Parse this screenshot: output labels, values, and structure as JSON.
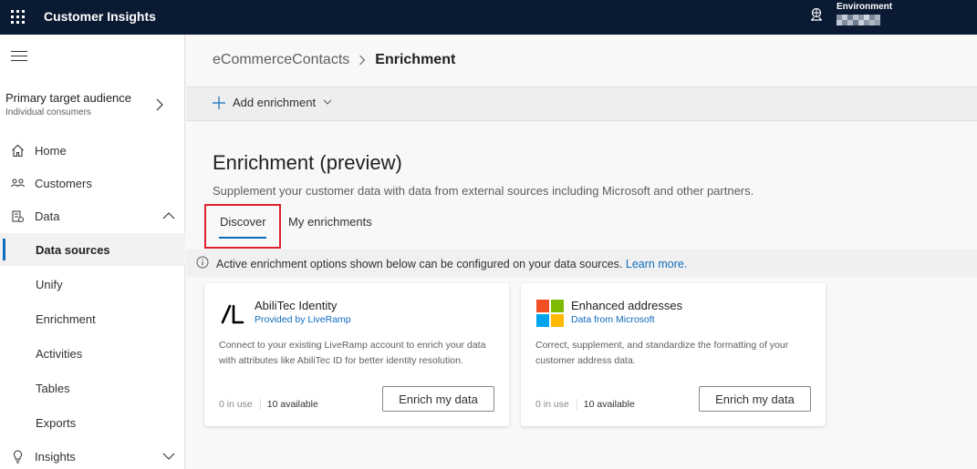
{
  "app": {
    "title": "Customer Insights"
  },
  "environment": {
    "label": "Environment",
    "value_icon": "redacted-value"
  },
  "sidebar": {
    "audience": {
      "title": "Primary target audience",
      "subtitle": "Individual consumers"
    },
    "items": [
      {
        "label": "Home",
        "icon": "home-icon"
      },
      {
        "label": "Customers",
        "icon": "customers-icon"
      },
      {
        "label": "Data",
        "icon": "data-icon"
      },
      {
        "label": "Data sources"
      },
      {
        "label": "Unify"
      },
      {
        "label": "Enrichment"
      },
      {
        "label": "Activities"
      },
      {
        "label": "Tables"
      },
      {
        "label": "Exports"
      },
      {
        "label": "Insights",
        "icon": "insights-icon"
      }
    ]
  },
  "breadcrumb": {
    "parent": "eCommerceContacts",
    "current": "Enrichment"
  },
  "commandbar": {
    "add_label": "Add enrichment"
  },
  "page": {
    "title": "Enrichment (preview)",
    "description": "Supplement your customer data with data from external sources including Microsoft and other partners."
  },
  "tabs": [
    {
      "label": "Discover",
      "selected": true
    },
    {
      "label": "My enrichments",
      "selected": false
    }
  ],
  "info": {
    "text": "Active enrichment options shown below can be configured on your data sources.",
    "link": "Learn more."
  },
  "cards": [
    {
      "title": "AbiliTec Identity",
      "provider": "Provided by LiveRamp",
      "description": "Connect to your existing LiveRamp account to enrich your data with attributes like AbiliTec ID for better identity resolution.",
      "in_use": "0 in use",
      "available": "10 available",
      "button": "Enrich my data",
      "logo": "liveramp-logo"
    },
    {
      "title": "Enhanced addresses",
      "provider": "Data from Microsoft",
      "description": "Correct, supplement, and standardize the formatting of your customer address data.",
      "in_use": "0 in use",
      "available": "10 available",
      "button": "Enrich my data",
      "logo": "microsoft-logo"
    }
  ],
  "colors": {
    "topbar": "#0b1a33",
    "accent": "#0f6cbd",
    "highlight": "#e0202b"
  }
}
